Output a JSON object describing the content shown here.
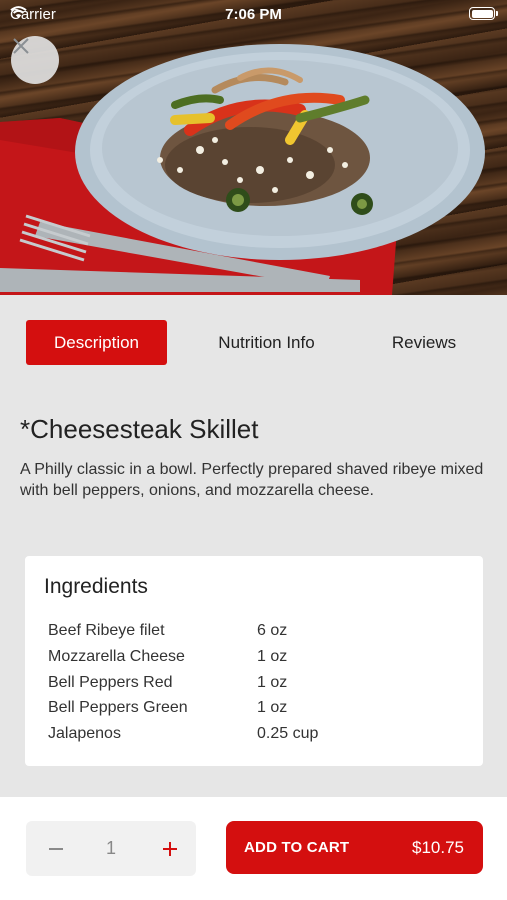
{
  "status_bar": {
    "carrier": "Carrier",
    "time": "7:06 PM"
  },
  "hero": {
    "image_alt": "Cheesesteak Skillet dish on plate"
  },
  "tabs": [
    {
      "label": "Description",
      "active": true
    },
    {
      "label": "Nutrition Info",
      "active": false
    },
    {
      "label": "Reviews",
      "active": false
    }
  ],
  "product": {
    "title": "*Cheesesteak Skillet",
    "description": "A Philly classic in a bowl. Perfectly prepared shaved ribeye mixed with bell peppers, onions, and mozzarella cheese."
  },
  "ingredients": {
    "heading": "Ingredients",
    "items": [
      {
        "name": "Beef Ribeye filet",
        "qty": "6 oz"
      },
      {
        "name": "Mozzarella Cheese",
        "qty": "1 oz"
      },
      {
        "name": "Bell Peppers Red",
        "qty": "1 oz"
      },
      {
        "name": "Bell Peppers Green",
        "qty": "1 oz"
      },
      {
        "name": "Jalapenos",
        "qty": "0.25 cup"
      }
    ]
  },
  "cart": {
    "quantity": "1",
    "add_label": "ADD TO CART",
    "price": "$10.75"
  },
  "colors": {
    "accent": "#d40f0f",
    "background": "#e6e6e6"
  }
}
